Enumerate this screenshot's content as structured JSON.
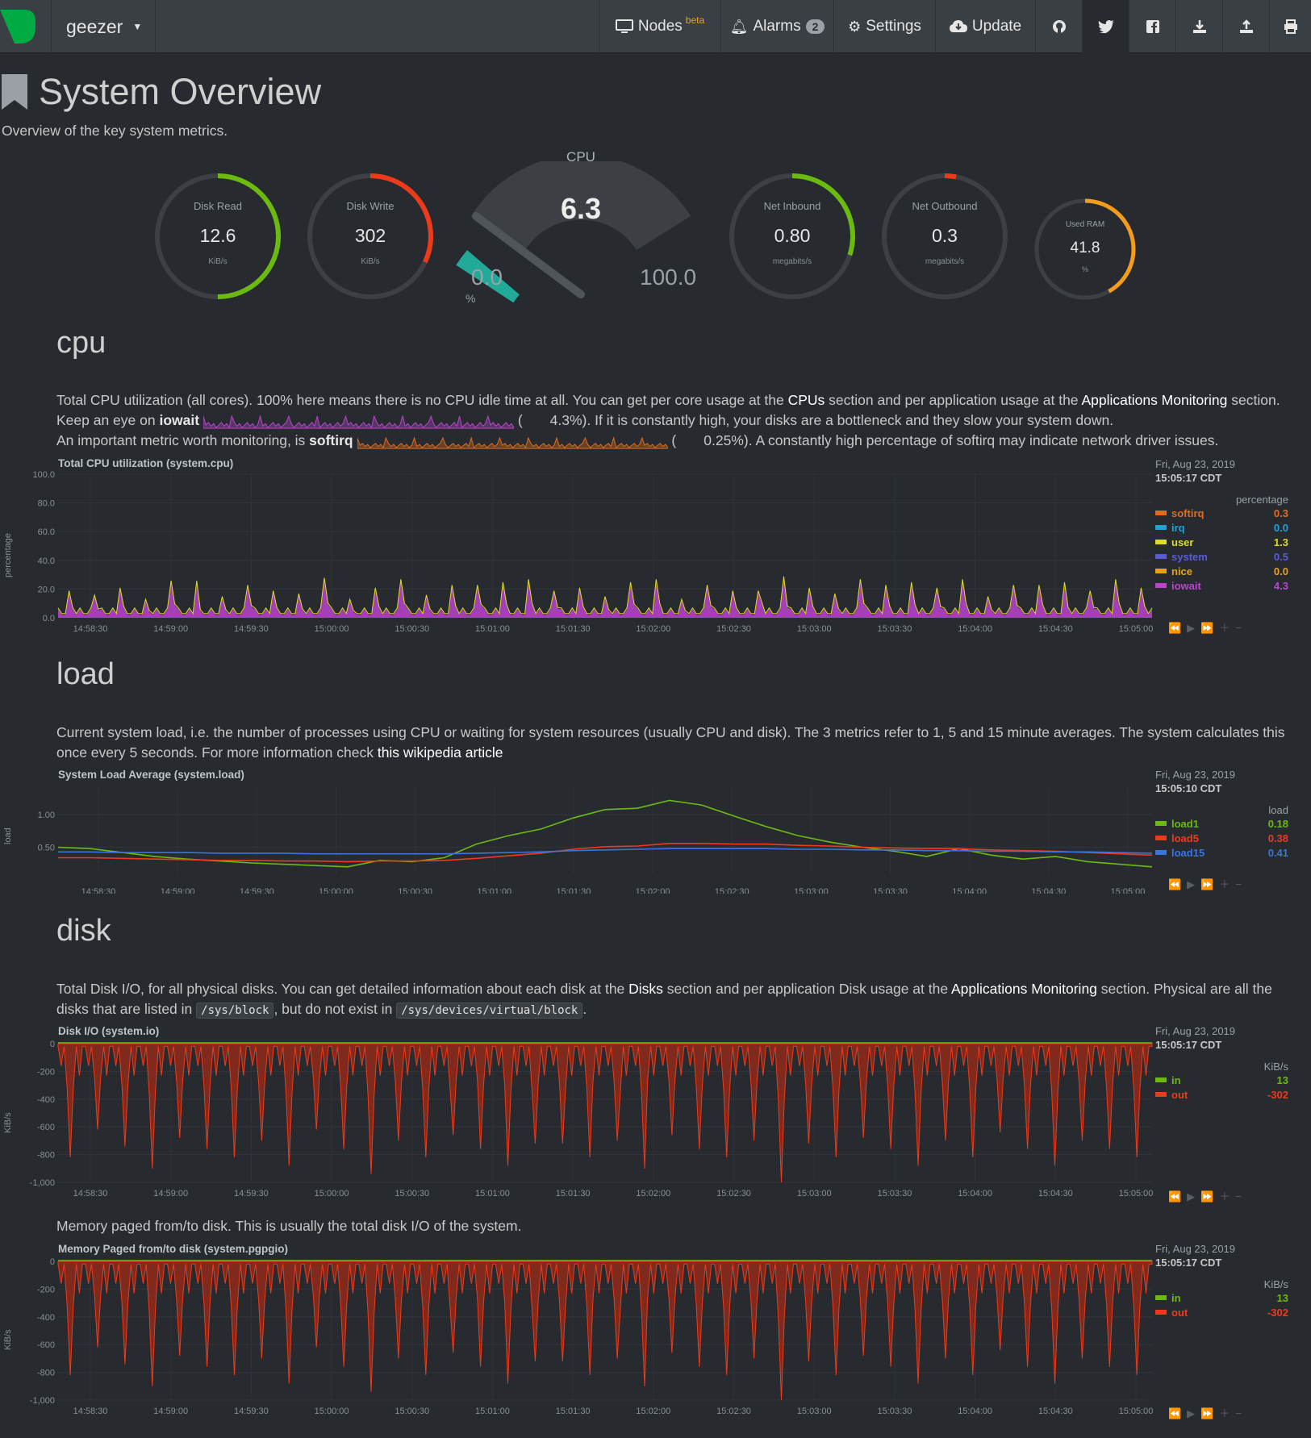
{
  "nav": {
    "host": "geezer",
    "nodes": "Nodes",
    "nodes_sup": "beta",
    "alarms": "Alarms",
    "alarms_count": "2",
    "settings": "Settings",
    "update": "Update"
  },
  "page": {
    "title": "System Overview",
    "subtitle": "Overview of the key system metrics."
  },
  "gauges": {
    "disk_read": {
      "label": "Disk Read",
      "value": "12.6",
      "unit": "KiB/s",
      "fraction": 0.5,
      "color": "#6cba0f"
    },
    "disk_write": {
      "label": "Disk Write",
      "value": "302",
      "unit": "KiB/s",
      "fraction": 0.32,
      "color": "#ee3a1b"
    },
    "cpu": {
      "label": "CPU",
      "value": "6.3",
      "min": "0.0",
      "max": "100.0",
      "unit": "%",
      "percent": 6.3,
      "color": "#22aa99"
    },
    "net_in": {
      "label": "Net Inbound",
      "value": "0.80",
      "unit": "megabits/s",
      "fraction": 0.3,
      "color": "#6cba0f"
    },
    "net_out": {
      "label": "Net Outbound",
      "value": "0.3",
      "unit": "megabits/s",
      "fraction": 0.03,
      "color": "#ee3a1b"
    },
    "ram": {
      "label": "Used RAM",
      "value": "41.8",
      "unit": "%",
      "fraction": 0.418,
      "color": "#f49d1a"
    }
  },
  "cpu_section": {
    "title": "cpu",
    "p1_a": "Total CPU utilization (all cores). 100% here means there is no CPU idle time at all. You can get per core usage at the ",
    "p1_link1": "CPUs",
    "p1_b": " section and per application usage at the ",
    "p1_link2": "Applications Monitoring",
    "p1_c": " section.",
    "p2_a": "Keep an eye on ",
    "p2_bold": "iowait",
    "p2_val": "(       4.3%)",
    "p2_b": ". If it is constantly high, your disks are a bottleneck and they slow your system down.",
    "p3_a": "An important metric worth monitoring, is ",
    "p3_bold": "softirq",
    "p3_val": "(       0.25%)",
    "p3_b": ". A constantly high percentage of softirq may indicate network driver issues.",
    "chart_title": "Total CPU utilization (system.cpu)",
    "date": "Fri, Aug 23, 2019",
    "time": "15:05:17 CDT",
    "units": "percentage",
    "ylabel": "percentage",
    "legend": [
      {
        "name": "softirq",
        "value": "0.3",
        "color": "#e06c1e"
      },
      {
        "name": "irq",
        "value": "0.0",
        "color": "#1ba4d6"
      },
      {
        "name": "user",
        "value": "1.3",
        "color": "#dddd22"
      },
      {
        "name": "system",
        "value": "0.5",
        "color": "#5b5bd6"
      },
      {
        "name": "nice",
        "value": "0.0",
        "color": "#e8a21a"
      },
      {
        "name": "iowait",
        "value": "4.3",
        "color": "#bb44cc"
      }
    ]
  },
  "load_section": {
    "title": "load",
    "p1": "Current system load, i.e. the number of processes using CPU or waiting for system resources (usually CPU and disk). The 3 metrics refer to 1, 5 and 15 minute averages. The system calculates this once every 5 seconds. For more information check ",
    "link": "this wikipedia article",
    "chart_title": "System Load Average (system.load)",
    "date": "Fri, Aug 23, 2019",
    "time": "15:05:10 CDT",
    "units": "load",
    "ylabel": "load",
    "legend": [
      {
        "name": "load1",
        "value": "0.18",
        "color": "#6cba0f"
      },
      {
        "name": "load5",
        "value": "0.38",
        "color": "#ee3a1b"
      },
      {
        "name": "load15",
        "value": "0.41",
        "color": "#3a74e0"
      }
    ]
  },
  "disk_section": {
    "title": "disk",
    "p1_a": "Total Disk I/O, for all physical disks. You can get detailed information about each disk at the ",
    "p1_link1": "Disks",
    "p1_b": " section and per application Disk usage at the ",
    "p1_link2": "Applications Monitoring",
    "p1_c": " section. Physical are all the disks that are listed in ",
    "code1": "/sys/block",
    "p1_d": ", but do not exist in ",
    "code2": "/sys/devices/virtual/block",
    "p1_e": ".",
    "io_title": "Disk I/O (system.io)",
    "io_date": "Fri, Aug 23, 2019",
    "io_time": "15:05:17 CDT",
    "io_units": "KiB/s",
    "ylabel": "KiB/s",
    "io_legend": [
      {
        "name": "in",
        "value": "13",
        "color": "#6cba0f"
      },
      {
        "name": "out",
        "value": "-302",
        "color": "#ee3a1b"
      }
    ],
    "pg_text": "Memory paged from/to disk. This is usually the total disk I/O of the system.",
    "pg_title": "Memory Paged from/to disk (system.pgpgio)",
    "pg_date": "Fri, Aug 23, 2019",
    "pg_time": "15:05:17 CDT",
    "pg_units": "KiB/s",
    "pg_legend": [
      {
        "name": "in",
        "value": "13",
        "color": "#6cba0f"
      },
      {
        "name": "out",
        "value": "-302",
        "color": "#ee3a1b"
      }
    ]
  },
  "chart_data": [
    {
      "type": "area",
      "title": "Total CPU utilization (system.cpu)",
      "ylabel": "percentage",
      "ylim": [
        0,
        100
      ],
      "yticks": [
        "100.0",
        "80.0",
        "60.0",
        "40.0",
        "20.0",
        "0.0"
      ],
      "xticks": [
        "14:58:30",
        "14:59:00",
        "14:59:30",
        "15:00:00",
        "15:00:30",
        "15:01:00",
        "15:01:30",
        "15:02:00",
        "15:02:30",
        "15:03:00",
        "15:03:30",
        "15:04:00",
        "15:04:30",
        "15:05:00"
      ],
      "series": [
        {
          "name": "iowait",
          "peaks": [
            18,
            15,
            20,
            12,
            25,
            14,
            22,
            18,
            16,
            27,
            12,
            20,
            26,
            15,
            22,
            24,
            26,
            18,
            20,
            14,
            24,
            26,
            12,
            22,
            18,
            28,
            20,
            16,
            26,
            22,
            24,
            20,
            26,
            14,
            22,
            24,
            18,
            26,
            20,
            15
          ]
        }
      ]
    },
    {
      "type": "line",
      "title": "System Load Average (system.load)",
      "ylabel": "load",
      "ylim": [
        0,
        1.3
      ],
      "yticks": [
        "1.00",
        "0.50"
      ],
      "xticks": [
        "14:58:30",
        "14:59:00",
        "14:59:30",
        "15:00:00",
        "15:00:30",
        "15:01:00",
        "15:01:30",
        "15:02:00",
        "15:02:30",
        "15:03:00",
        "15:03:30",
        "15:04:00",
        "15:04:30",
        "15:05:00"
      ],
      "series": [
        {
          "name": "load1",
          "values": [
            0.5,
            0.48,
            0.42,
            0.36,
            0.32,
            0.29,
            0.26,
            0.24,
            0.22,
            0.2,
            0.3,
            0.28,
            0.34,
            0.55,
            0.68,
            0.78,
            0.95,
            1.08,
            1.1,
            1.22,
            1.15,
            0.98,
            0.82,
            0.68,
            0.58,
            0.5,
            0.44,
            0.36,
            0.48,
            0.38,
            0.32,
            0.36,
            0.28,
            0.24,
            0.2
          ]
        },
        {
          "name": "load5",
          "values": [
            0.34,
            0.34,
            0.33,
            0.32,
            0.31,
            0.3,
            0.3,
            0.29,
            0.29,
            0.28,
            0.29,
            0.29,
            0.3,
            0.33,
            0.37,
            0.41,
            0.47,
            0.51,
            0.52,
            0.56,
            0.56,
            0.55,
            0.55,
            0.53,
            0.52,
            0.5,
            0.49,
            0.48,
            0.48,
            0.46,
            0.45,
            0.44,
            0.42,
            0.4,
            0.38
          ]
        },
        {
          "name": "load15",
          "values": [
            0.43,
            0.43,
            0.42,
            0.42,
            0.42,
            0.41,
            0.41,
            0.41,
            0.4,
            0.4,
            0.4,
            0.4,
            0.4,
            0.41,
            0.42,
            0.43,
            0.45,
            0.46,
            0.47,
            0.48,
            0.48,
            0.48,
            0.48,
            0.47,
            0.47,
            0.46,
            0.46,
            0.45,
            0.45,
            0.44,
            0.44,
            0.43,
            0.43,
            0.42,
            0.41
          ]
        }
      ]
    },
    {
      "type": "area",
      "title": "Disk I/O (system.io)",
      "ylabel": "KiB/s",
      "ylim": [
        -1000,
        0
      ],
      "yticks": [
        "0",
        "-200",
        "-400",
        "-600",
        "-800",
        "-1,000"
      ],
      "xticks": [
        "14:58:30",
        "14:59:00",
        "14:59:30",
        "15:00:00",
        "15:00:30",
        "15:01:00",
        "15:01:30",
        "15:02:00",
        "15:02:30",
        "15:03:00",
        "15:03:30",
        "15:04:00",
        "15:04:30",
        "15:05:00"
      ],
      "series": [
        {
          "name": "out",
          "dips": [
            -820,
            -620,
            -740,
            -900,
            -680,
            -760,
            -820,
            -700,
            -880,
            -620,
            -760,
            -940,
            -700,
            -820,
            -660,
            -760,
            -880,
            -720,
            -820,
            -700,
            -900,
            -660,
            -760,
            -820,
            -700,
            -1000,
            -720,
            -820,
            -680,
            -760,
            -880,
            -700,
            -820,
            -640,
            -760,
            -880,
            -700,
            -760,
            -820,
            -700
          ]
        },
        {
          "name": "in",
          "constant": 13
        }
      ]
    },
    {
      "type": "area",
      "title": "Memory Paged from/to disk (system.pgpgio)",
      "ylabel": "KiB/s",
      "ylim": [
        -1000,
        0
      ],
      "yticks": [
        "0",
        "-200",
        "-400",
        "-600",
        "-800",
        "-1,000"
      ],
      "xticks": [
        "14:58:30",
        "14:59:00",
        "14:59:30",
        "15:00:00",
        "15:00:30",
        "15:01:00",
        "15:01:30",
        "15:02:00",
        "15:02:30",
        "15:03:00",
        "15:03:30",
        "15:04:00",
        "15:04:30",
        "15:05:00"
      ],
      "series": [
        {
          "name": "out",
          "dips": [
            -820,
            -620,
            -740,
            -900,
            -680,
            -760,
            -820,
            -700,
            -880,
            -620,
            -760,
            -940,
            -700,
            -820,
            -660,
            -760,
            -880,
            -720,
            -820,
            -700,
            -900,
            -660,
            -760,
            -820,
            -700,
            -1000,
            -720,
            -820,
            -680,
            -760,
            -880,
            -700,
            -820,
            -640,
            -760,
            -880,
            -700,
            -760,
            -820,
            -700
          ]
        },
        {
          "name": "in",
          "constant": 13
        }
      ]
    }
  ]
}
